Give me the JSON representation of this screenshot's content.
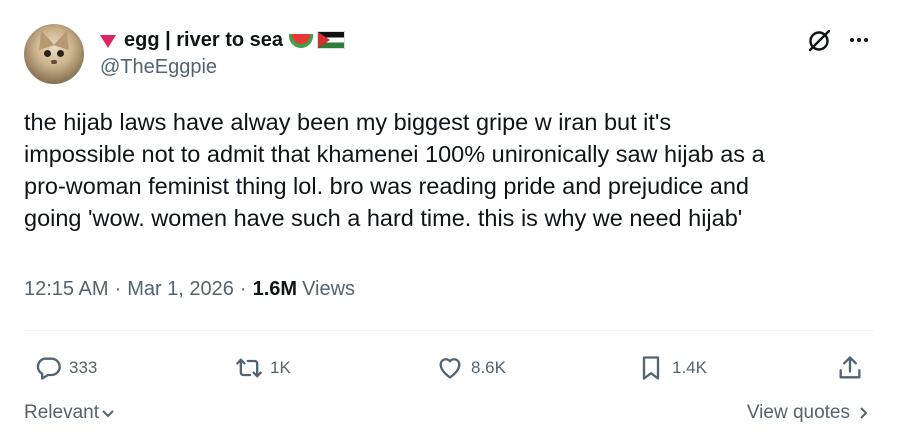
{
  "author": {
    "display_name": "egg | river to sea",
    "handle": "@TheEggpie",
    "name_prefix_icon": "red-heart-icon",
    "name_suffix_icons": [
      "watermelon-icon",
      "palestine-flag-icon"
    ]
  },
  "tweet": {
    "text": "the hijab laws have alway been my biggest gripe w iran but it's\nimpossible not to admit that khamenei 100% unironically saw hijab as a\npro-woman feminist thing lol. bro was reading pride and prejudice and\ngoing 'wow. women have such a hard time. this is why we need hijab'"
  },
  "meta": {
    "time": "12:15 AM",
    "separator": "·",
    "date": "Mar 1, 2026",
    "views_count": "1.6M",
    "views_label": "Views"
  },
  "actions": {
    "replies": "333",
    "reposts": "1K",
    "likes": "8.6K",
    "bookmarks": "1.4K"
  },
  "footer": {
    "sort_label": "Relevant",
    "view_quotes_label": "View quotes"
  },
  "colors": {
    "text_primary": "#0f1419",
    "text_secondary": "#536471",
    "divider": "#eff3f4"
  }
}
